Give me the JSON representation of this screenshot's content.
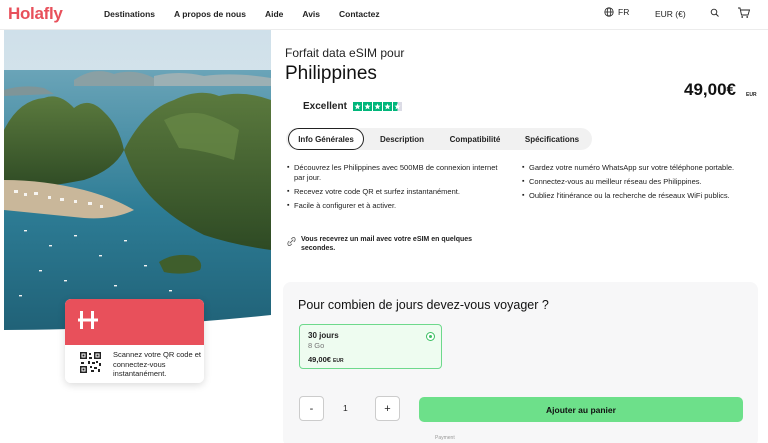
{
  "header": {
    "logo": "Holafly",
    "nav": [
      "Destinations",
      "A propos de nous",
      "Aide",
      "Avis",
      "Contactez"
    ],
    "language": "FR",
    "currency": "EUR (€)"
  },
  "promo": {
    "text": "Scannez votre QR code et connectez-vous instantanément."
  },
  "product": {
    "subtitle": "Forfait data eSIM pour",
    "title": "Philippines",
    "price": "49,00€",
    "price_currency": "EUR",
    "rating_label": "Excellent",
    "rating_stars": 4.5
  },
  "tabs": [
    {
      "label": "Info Générales",
      "active": true
    },
    {
      "label": "Description",
      "active": false
    },
    {
      "label": "Compatibilité",
      "active": false
    },
    {
      "label": "Spécifications",
      "active": false
    }
  ],
  "features_left": [
    "Découvrez les Philippines avec 500MB de connexion internet par jour.",
    "Recevez votre code QR et surfez instantanément.",
    "Facile à configurer et à activer."
  ],
  "features_right": [
    "Gardez votre numéro WhatsApp sur votre téléphone portable.",
    "Connectez-vous au meilleur réseau des Philippines.",
    "Oubliez l'itinérance ou la recherche de réseaux WiFi publics."
  ],
  "mail_note": "Vous recevrez un mail avec votre eSIM en quelques secondes.",
  "plan": {
    "question": "Pour combien de jours devez-vous voyager ?",
    "option": {
      "days": "30 jours",
      "data": "8 Go",
      "price": "49,00€",
      "currency": "EUR"
    },
    "quantity": "1",
    "minus": "-",
    "plus": "+",
    "add_to_cart": "Ajouter au panier",
    "payment_label": "Payment"
  },
  "colors": {
    "brand": "#e8505b",
    "accent_green": "#6de08a",
    "trustpilot": "#00b67a"
  }
}
